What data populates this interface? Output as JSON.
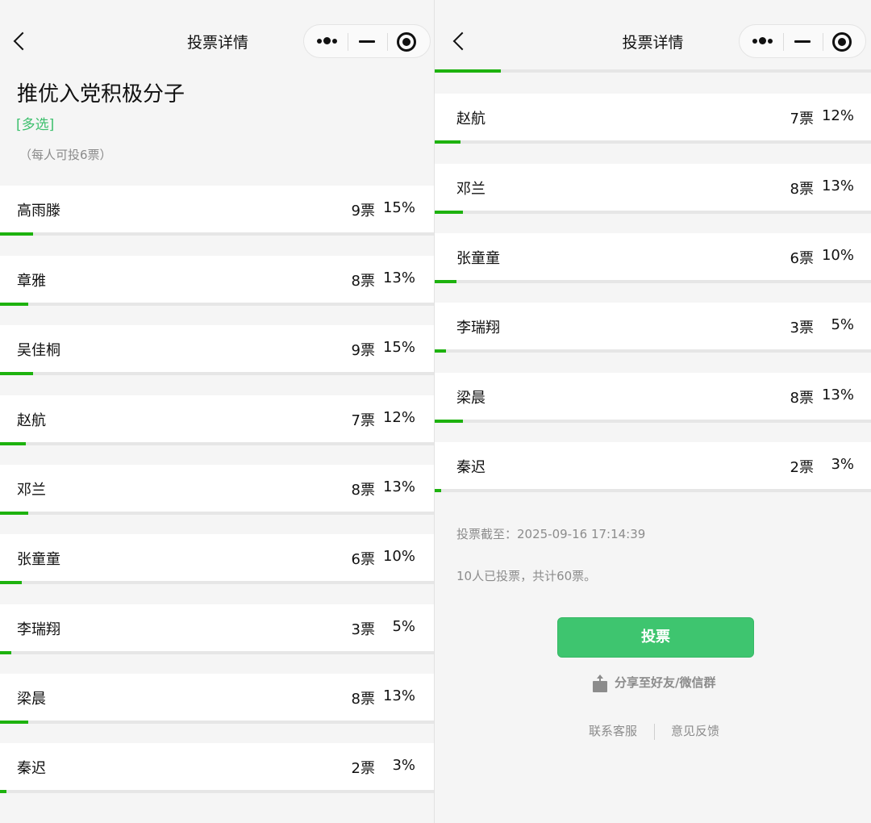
{
  "nav": {
    "title": "投票详情"
  },
  "poll": {
    "title": "推优入党积极分子",
    "type_tag": "[多选]",
    "limit_note": "（每人可投6票）"
  },
  "colors": {
    "accent": "#3ec56f",
    "progress": "#1db20e"
  },
  "options": [
    {
      "name": "高雨滕",
      "votes": "9票",
      "percent": "15%",
      "ratio": 0.15
    },
    {
      "name": "章雅",
      "votes": "8票",
      "percent": "13%",
      "ratio": 0.13
    },
    {
      "name": "吴佳桐",
      "votes": "9票",
      "percent": "15%",
      "ratio": 0.15
    },
    {
      "name": "赵航",
      "votes": "7票",
      "percent": "12%",
      "ratio": 0.12
    },
    {
      "name": "邓兰",
      "votes": "8票",
      "percent": "13%",
      "ratio": 0.13
    },
    {
      "name": "张童童",
      "votes": "6票",
      "percent": "10%",
      "ratio": 0.1
    },
    {
      "name": "李瑞翔",
      "votes": "3票",
      "percent": "5%",
      "ratio": 0.05
    },
    {
      "name": "梁晨",
      "votes": "8票",
      "percent": "13%",
      "ratio": 0.13
    },
    {
      "name": "秦迟",
      "votes": "2票",
      "percent": "3%",
      "ratio": 0.03
    }
  ],
  "footer": {
    "deadline": "投票截至：2025-09-16 17:14:39",
    "summary": "10人已投票，共计60票。",
    "vote_button": "投票",
    "share_label": "分享至好友/微信群",
    "contact_service": "联系客服",
    "feedback": "意见反馈"
  }
}
